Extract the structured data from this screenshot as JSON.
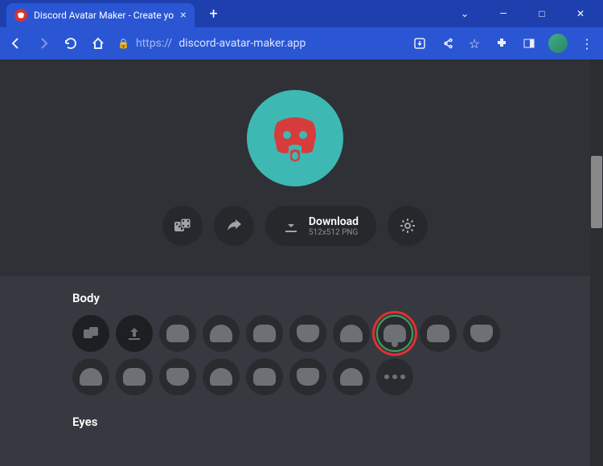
{
  "window": {
    "tab_title": "Discord Avatar Maker - Create yo",
    "url_scheme": "https://",
    "url_host": "discord-avatar-maker.app"
  },
  "hero": {
    "download_label": "Download",
    "download_sub": "512x512 PNG"
  },
  "sections": {
    "body_title": "Body",
    "eyes_title": "Eyes"
  },
  "colors": {
    "avatar_bg": "#3eb8b3",
    "avatar_fg": "#d63c3c",
    "selected_ring": "#3ba55c",
    "highlight_ring": "#e03030"
  }
}
